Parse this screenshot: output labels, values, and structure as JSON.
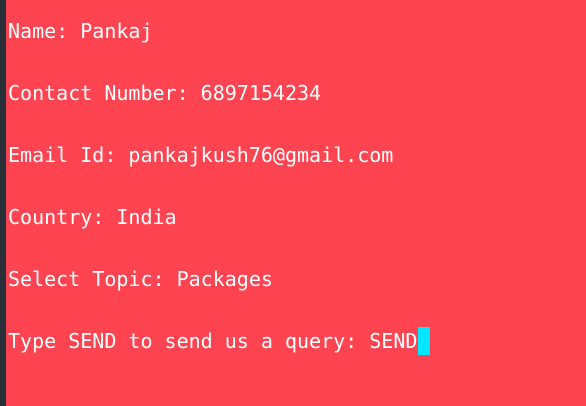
{
  "terminal": {
    "lines": [
      {
        "label": "Name: ",
        "value": "Pankaj"
      },
      {
        "label": "Contact Number: ",
        "value": "6897154234"
      },
      {
        "label": "Email Id: ",
        "value": "pankajkush76@gmail.com"
      },
      {
        "label": "Country: ",
        "value": "India"
      },
      {
        "label": "Select Topic: ",
        "value": "Packages"
      },
      {
        "label": "Type SEND to send us a query: ",
        "value": "SEND"
      }
    ],
    "colors": {
      "background": "#ff4451",
      "text": "#ffffff",
      "cursor": "#00e7ff",
      "edge": "#2b2f3a"
    }
  }
}
